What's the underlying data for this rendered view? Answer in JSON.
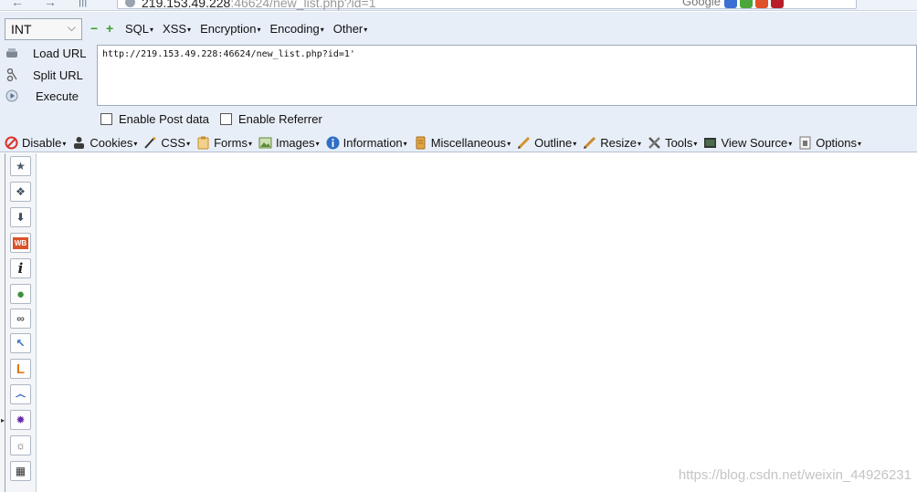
{
  "browser": {
    "back_glyph": "←",
    "forward_glyph": "→",
    "address_host": "219.153.49.228",
    "address_rest": ":46624/new_list.php?id=1",
    "search_engine": "Google"
  },
  "hackbar": {
    "type_select": "INT",
    "minus": "−",
    "plus": "+",
    "menus": [
      "SQL",
      "XSS",
      "Encryption",
      "Encoding",
      "Other"
    ],
    "actions": [
      "Load URL",
      "Split URL",
      "Execute"
    ],
    "url_value": "http://219.153.49.228:46624/new_list.php?id=1'",
    "enable_post": "Enable Post data",
    "enable_referrer": "Enable Referrer"
  },
  "webdev": {
    "items": [
      {
        "label": "Disable",
        "icon": "disable-icon",
        "color": "#d8342c"
      },
      {
        "label": "Cookies",
        "icon": "cookies-icon",
        "color": "#3b3b3b"
      },
      {
        "label": "CSS",
        "icon": "css-icon",
        "color": "#d9a21b"
      },
      {
        "label": "Forms",
        "icon": "forms-icon",
        "color": "#c9892b"
      },
      {
        "label": "Images",
        "icon": "images-icon",
        "color": "#5f8a3c"
      },
      {
        "label": "Information",
        "icon": "information-icon",
        "color": "#2d6fc4"
      },
      {
        "label": "Miscellaneous",
        "icon": "miscellaneous-icon",
        "color": "#c98a2c"
      },
      {
        "label": "Outline",
        "icon": "outline-icon",
        "color": "#d2952e"
      },
      {
        "label": "Resize",
        "icon": "resize-icon",
        "color": "#c98a2c"
      },
      {
        "label": "Tools",
        "icon": "tools-icon",
        "color": "#555555"
      },
      {
        "label": "View Source",
        "icon": "view-source-icon",
        "color": "#333333"
      },
      {
        "label": "Options",
        "icon": "options-icon",
        "color": "#777777"
      }
    ]
  },
  "sidebar": {
    "marker": "▸",
    "buttons": [
      {
        "icon": "bookmark-star-icon",
        "glyph": "★",
        "color": "#4a5a6a"
      },
      {
        "icon": "addons-puzzle-icon",
        "glyph": "❖",
        "color": "#3d4d5d"
      },
      {
        "icon": "download-icon",
        "glyph": "⬇",
        "color": "#3d4d5d"
      },
      {
        "icon": "wb-icon",
        "glyph": "WB",
        "color": "#d9532b"
      },
      {
        "icon": "info-italic-icon",
        "glyph": "i",
        "color": "#222222"
      },
      {
        "icon": "green-ball-icon",
        "glyph": "●",
        "color": "#3f8f3c"
      },
      {
        "icon": "link-chain-icon",
        "glyph": "∞",
        "color": "#555555"
      },
      {
        "icon": "cursor-select-icon",
        "glyph": "↖",
        "color": "#2e6fbf"
      },
      {
        "icon": "orange-l-icon",
        "glyph": "L",
        "color": "#e07a12"
      },
      {
        "icon": "swirl-icon",
        "glyph": "෴",
        "color": "#2a5fbf"
      },
      {
        "icon": "virus-icon",
        "glyph": "✹",
        "color": "#6b2ca8"
      },
      {
        "icon": "palette-icon",
        "glyph": "☼",
        "color": "#555555"
      },
      {
        "icon": "layout-grid-icon",
        "glyph": "▦",
        "color": "#333333"
      }
    ]
  },
  "watermark": "https://blog.csdn.net/weixin_44926231"
}
